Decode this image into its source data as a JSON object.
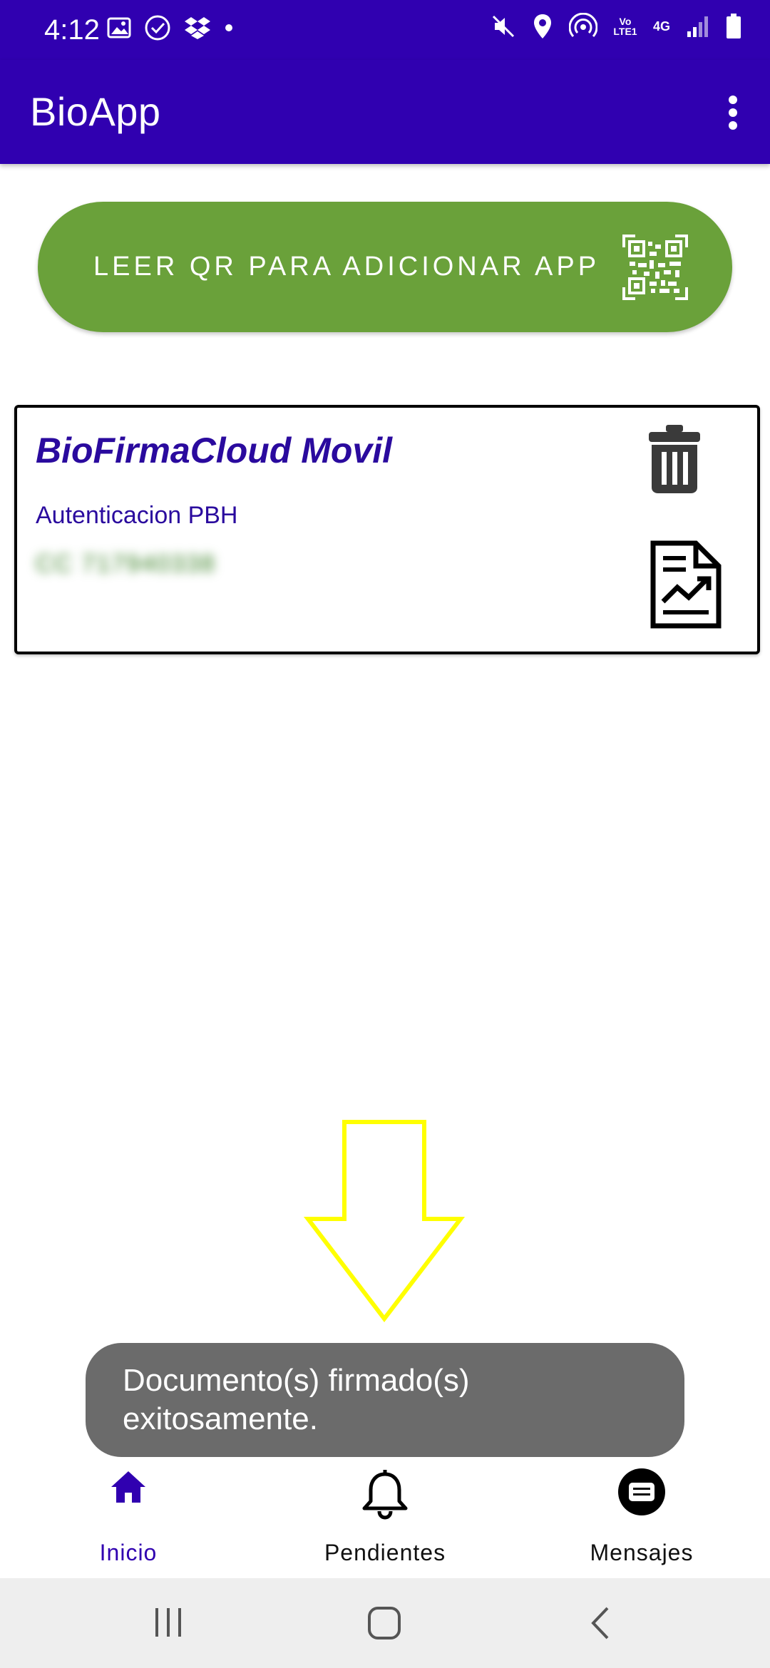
{
  "status_bar": {
    "time": "4:12",
    "left_icons": [
      "gallery-icon",
      "check-circle-icon",
      "dropbox-icon",
      "dot-icon"
    ],
    "right_icons": [
      "mute-icon",
      "location-icon",
      "hotspot-icon",
      "volte-icon",
      "network-4g-icon",
      "signal-icon",
      "battery-icon"
    ],
    "volte_text": "Vo LTE1",
    "network_text": "4G"
  },
  "app_bar": {
    "title": "BioApp",
    "menu_icon": "more-vert-icon"
  },
  "qr_button": {
    "label": "LEER QR PARA ADICIONAR APP",
    "icon": "qr-code-icon",
    "color": "#6aa13a"
  },
  "app_card": {
    "title": "BioFirmaCloud Movil",
    "subtitle": "Autenticacion PBH",
    "blurred_value": "CC 717940338",
    "actions": [
      "trash-icon",
      "report-icon"
    ]
  },
  "toast": {
    "message": "Documento(s) firmado(s) exitosamente."
  },
  "bottom_nav": {
    "items": [
      {
        "label": "Inicio",
        "icon": "home-icon",
        "active": true
      },
      {
        "label": "Pendientes",
        "icon": "bell-icon",
        "active": false
      },
      {
        "label": "Mensajes",
        "icon": "message-icon",
        "active": false
      }
    ]
  },
  "system_nav": {
    "buttons": [
      "recents-icon",
      "home-circle-icon",
      "back-icon"
    ]
  },
  "colors": {
    "primary": "#3000b0",
    "accent_green": "#6aa13a",
    "annotation_arrow": "#ffff00",
    "toast_bg": "#6b6b6b"
  }
}
